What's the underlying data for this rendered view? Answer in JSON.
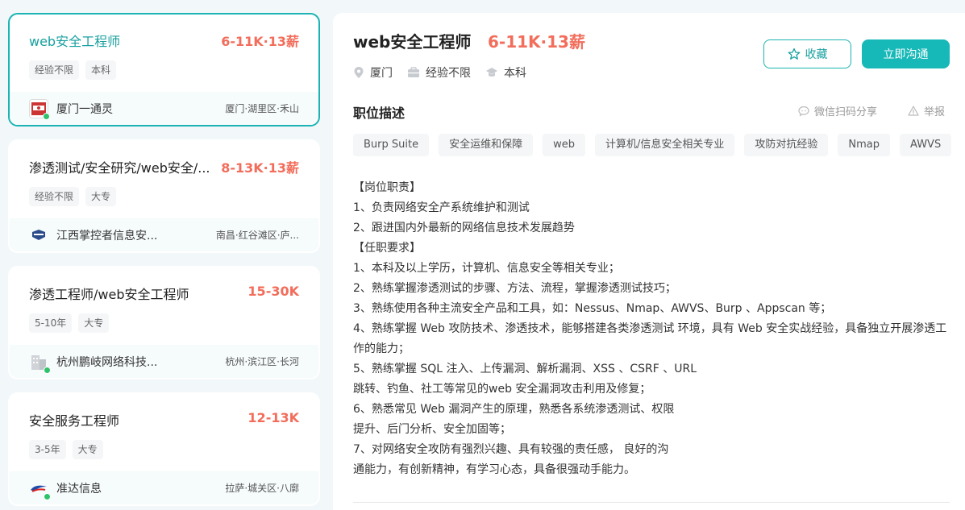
{
  "jobs": [
    {
      "title": "web安全工程师",
      "salary": "6-11K·13薪",
      "tags": [
        "经验不限",
        "本科"
      ],
      "company": "厦门一通灵",
      "location": "厦门·湖里区·禾山"
    },
    {
      "title": "渗透测试/安全研究/web安全/...",
      "salary": "8-13K·13薪",
      "tags": [
        "经验不限",
        "大专"
      ],
      "company": "江西掌控者信息安...",
      "location": "南昌·红谷滩区·庐..."
    },
    {
      "title": "渗透工程师/web安全工程师",
      "salary": "15-30K",
      "tags": [
        "5-10年",
        "大专"
      ],
      "company": "杭州鹏岐网络科技...",
      "location": "杭州·滨江区·长河"
    },
    {
      "title": "安全服务工程师",
      "salary": "12-13K",
      "tags": [
        "3-5年",
        "大专"
      ],
      "company": "准达信息",
      "location": "拉萨·城关区·八廓"
    }
  ],
  "detail": {
    "title": "web安全工程师",
    "salary": "6-11K·13薪",
    "city": "厦门",
    "experience": "经验不限",
    "education": "本科",
    "fav_label": "收藏",
    "chat_label": "立即沟通",
    "section_title": "职位描述",
    "share_label": "微信扫码分享",
    "report_label": "举报",
    "skills": [
      "Burp Suite",
      "安全运维和保障",
      "web",
      "计算机/信息安全相关专业",
      "攻防对抗经验",
      "Nmap",
      "AWVS"
    ],
    "description": [
      "【岗位职责】",
      "1、负责网络安全产系统维护和测试",
      "2、跟进国内外最新的网络信息技术发展趋势",
      "【任职要求】",
      "1、本科及以上学历，计算机、信息安全等相关专业；",
      "2、熟练掌握渗透测试的步骤、方法、流程，掌握渗透测试技巧；",
      "3、熟练使用各种主流安全产品和工具，如：Nessus、Nmap、AWVS、Burp 、Appscan 等；",
      "4、熟练掌握 Web 攻防技术、渗透技术，能够搭建各类渗透测试 环境，具有 Web 安全实战经验，具备独立开展渗透工作的能力；",
      "5、熟练掌握 SQL 注入、上传漏洞、解析漏洞、XSS 、CSRF 、URL",
      "跳转、钓鱼、社工等常见的web 安全漏洞攻击利用及修复；",
      "6、熟悉常见 Web 漏洞产生的原理，熟悉各系统渗透测试、权限",
      "提升、后门分析、安全加固等；",
      "7、对网络安全攻防有强烈兴趣、具有较强的责任感， 良好的沟",
      "通能力，有创新精神，有学习心态，具备很强动手能力。"
    ]
  },
  "colors": {
    "accent": "#1bb3b3",
    "salary": "#f26d5b",
    "online": "#2ec26a"
  }
}
